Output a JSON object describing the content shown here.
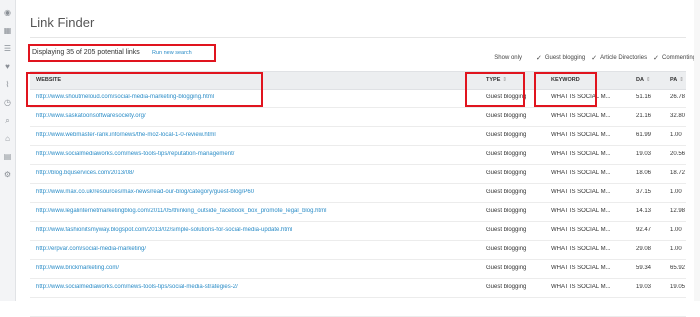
{
  "sidebar": {
    "icons": [
      "gauge-icon",
      "dashboard-icon",
      "list-icon",
      "heartbeat-icon",
      "chart-icon",
      "clock-icon",
      "search-icon",
      "tags-icon",
      "document-icon",
      "gear-icon"
    ],
    "glyphs": [
      "◉",
      "▦",
      "☰",
      "♥",
      "⌇",
      "◷",
      "⌕",
      "⌂",
      "▤",
      "⚙"
    ]
  },
  "page": {
    "title": "Link Finder",
    "display_text": "Displaying 35 of 205 potential links",
    "run_new_search": "Run new search"
  },
  "filters": {
    "show_only": "Show only",
    "options": [
      {
        "label": "Guest blogging",
        "checked": true
      },
      {
        "label": "Article Directories",
        "checked": true
      },
      {
        "label": "Commenting",
        "checked": true
      }
    ]
  },
  "table": {
    "headers": {
      "website": "WEBSITE",
      "type": "TYPE",
      "keyword": "KEYWORD",
      "da": "DA",
      "pa": "PA"
    },
    "rows": [
      {
        "url": "http://www.shoutmeloud.com/social-media-marketing-blogging.html",
        "type": "Guest blogging",
        "keyword": "WHAT IS SOCIAL M...",
        "da": "51.16",
        "pa": "26.78"
      },
      {
        "url": "http://www.saskatoonsoftwaresociety.org/",
        "type": "Guest blogging",
        "keyword": "WHAT IS SOCIAL M...",
        "da": "21.16",
        "pa": "32.80"
      },
      {
        "url": "http://www.webmaster-rank.info/news/the-moz-local-1-0-review.html",
        "type": "Guest blogging",
        "keyword": "WHAT IS SOCIAL M...",
        "da": "61.99",
        "pa": "1.00"
      },
      {
        "url": "http://www.socialmediaworks.com/news-tools-tips/reputation-management/",
        "type": "Guest blogging",
        "keyword": "WHAT IS SOCIAL M...",
        "da": "19.03",
        "pa": "20.56"
      },
      {
        "url": "http://blog.bquservices.com/2013/08/",
        "type": "Guest blogging",
        "keyword": "WHAT IS SOCIAL M...",
        "da": "18.06",
        "pa": "18.72"
      },
      {
        "url": "http://www.max.co.uk/resources/max-news/read-our-blog/category/guest-blog/P60",
        "type": "Guest blogging",
        "keyword": "WHAT IS SOCIAL M...",
        "da": "37.15",
        "pa": "1.00"
      },
      {
        "url": "http://www.legalinternetmarketingblog.com/2011/05/thinking_outside_facebook_box_promote_legal_blog.html",
        "type": "Guest blogging",
        "keyword": "WHAT IS SOCIAL M...",
        "da": "14.13",
        "pa": "12.98"
      },
      {
        "url": "http://www.fashionitsmyway.blogspot.com/2013/02/simple-solutions-for-social-media-update.html",
        "type": "Guest blogging",
        "keyword": "WHAT IS SOCIAL M...",
        "da": "92.47",
        "pa": "1.00"
      },
      {
        "url": "http://erpvar.com/social-media-marketing/",
        "type": "Guest blogging",
        "keyword": "WHAT IS SOCIAL M...",
        "da": "29.08",
        "pa": "1.00"
      },
      {
        "url": "http://www.brickmarketing.com/",
        "type": "Guest blogging",
        "keyword": "WHAT IS SOCIAL M...",
        "da": "59.34",
        "pa": "65.92"
      },
      {
        "url": "http://www.socialmediaworks.com/news-tools-tips/social-media-strategies-2/",
        "type": "Guest blogging",
        "keyword": "WHAT IS SOCIAL M...",
        "da": "19.03",
        "pa": "19.05"
      },
      {
        "url": "",
        "type": "",
        "keyword": "",
        "da": "",
        "pa": ""
      }
    ]
  },
  "colors": {
    "link": "#2a8cc7",
    "highlight": "#e0141e",
    "header_bg": "#eceef0"
  }
}
